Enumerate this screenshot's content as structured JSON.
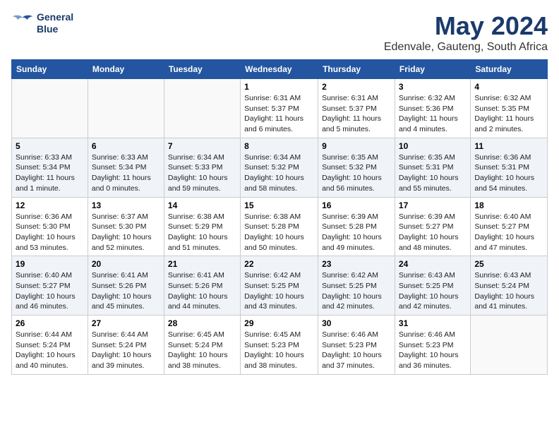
{
  "header": {
    "logo_line1": "General",
    "logo_line2": "Blue",
    "month": "May 2024",
    "location": "Edenvale, Gauteng, South Africa"
  },
  "days_of_week": [
    "Sunday",
    "Monday",
    "Tuesday",
    "Wednesday",
    "Thursday",
    "Friday",
    "Saturday"
  ],
  "weeks": [
    [
      {
        "day": "",
        "info": ""
      },
      {
        "day": "",
        "info": ""
      },
      {
        "day": "",
        "info": ""
      },
      {
        "day": "1",
        "info": "Sunrise: 6:31 AM\nSunset: 5:37 PM\nDaylight: 11 hours\nand 6 minutes."
      },
      {
        "day": "2",
        "info": "Sunrise: 6:31 AM\nSunset: 5:37 PM\nDaylight: 11 hours\nand 5 minutes."
      },
      {
        "day": "3",
        "info": "Sunrise: 6:32 AM\nSunset: 5:36 PM\nDaylight: 11 hours\nand 4 minutes."
      },
      {
        "day": "4",
        "info": "Sunrise: 6:32 AM\nSunset: 5:35 PM\nDaylight: 11 hours\nand 2 minutes."
      }
    ],
    [
      {
        "day": "5",
        "info": "Sunrise: 6:33 AM\nSunset: 5:34 PM\nDaylight: 11 hours\nand 1 minute."
      },
      {
        "day": "6",
        "info": "Sunrise: 6:33 AM\nSunset: 5:34 PM\nDaylight: 11 hours\nand 0 minutes."
      },
      {
        "day": "7",
        "info": "Sunrise: 6:34 AM\nSunset: 5:33 PM\nDaylight: 10 hours\nand 59 minutes."
      },
      {
        "day": "8",
        "info": "Sunrise: 6:34 AM\nSunset: 5:32 PM\nDaylight: 10 hours\nand 58 minutes."
      },
      {
        "day": "9",
        "info": "Sunrise: 6:35 AM\nSunset: 5:32 PM\nDaylight: 10 hours\nand 56 minutes."
      },
      {
        "day": "10",
        "info": "Sunrise: 6:35 AM\nSunset: 5:31 PM\nDaylight: 10 hours\nand 55 minutes."
      },
      {
        "day": "11",
        "info": "Sunrise: 6:36 AM\nSunset: 5:31 PM\nDaylight: 10 hours\nand 54 minutes."
      }
    ],
    [
      {
        "day": "12",
        "info": "Sunrise: 6:36 AM\nSunset: 5:30 PM\nDaylight: 10 hours\nand 53 minutes."
      },
      {
        "day": "13",
        "info": "Sunrise: 6:37 AM\nSunset: 5:30 PM\nDaylight: 10 hours\nand 52 minutes."
      },
      {
        "day": "14",
        "info": "Sunrise: 6:38 AM\nSunset: 5:29 PM\nDaylight: 10 hours\nand 51 minutes."
      },
      {
        "day": "15",
        "info": "Sunrise: 6:38 AM\nSunset: 5:28 PM\nDaylight: 10 hours\nand 50 minutes."
      },
      {
        "day": "16",
        "info": "Sunrise: 6:39 AM\nSunset: 5:28 PM\nDaylight: 10 hours\nand 49 minutes."
      },
      {
        "day": "17",
        "info": "Sunrise: 6:39 AM\nSunset: 5:27 PM\nDaylight: 10 hours\nand 48 minutes."
      },
      {
        "day": "18",
        "info": "Sunrise: 6:40 AM\nSunset: 5:27 PM\nDaylight: 10 hours\nand 47 minutes."
      }
    ],
    [
      {
        "day": "19",
        "info": "Sunrise: 6:40 AM\nSunset: 5:27 PM\nDaylight: 10 hours\nand 46 minutes."
      },
      {
        "day": "20",
        "info": "Sunrise: 6:41 AM\nSunset: 5:26 PM\nDaylight: 10 hours\nand 45 minutes."
      },
      {
        "day": "21",
        "info": "Sunrise: 6:41 AM\nSunset: 5:26 PM\nDaylight: 10 hours\nand 44 minutes."
      },
      {
        "day": "22",
        "info": "Sunrise: 6:42 AM\nSunset: 5:25 PM\nDaylight: 10 hours\nand 43 minutes."
      },
      {
        "day": "23",
        "info": "Sunrise: 6:42 AM\nSunset: 5:25 PM\nDaylight: 10 hours\nand 42 minutes."
      },
      {
        "day": "24",
        "info": "Sunrise: 6:43 AM\nSunset: 5:25 PM\nDaylight: 10 hours\nand 42 minutes."
      },
      {
        "day": "25",
        "info": "Sunrise: 6:43 AM\nSunset: 5:24 PM\nDaylight: 10 hours\nand 41 minutes."
      }
    ],
    [
      {
        "day": "26",
        "info": "Sunrise: 6:44 AM\nSunset: 5:24 PM\nDaylight: 10 hours\nand 40 minutes."
      },
      {
        "day": "27",
        "info": "Sunrise: 6:44 AM\nSunset: 5:24 PM\nDaylight: 10 hours\nand 39 minutes."
      },
      {
        "day": "28",
        "info": "Sunrise: 6:45 AM\nSunset: 5:24 PM\nDaylight: 10 hours\nand 38 minutes."
      },
      {
        "day": "29",
        "info": "Sunrise: 6:45 AM\nSunset: 5:23 PM\nDaylight: 10 hours\nand 38 minutes."
      },
      {
        "day": "30",
        "info": "Sunrise: 6:46 AM\nSunset: 5:23 PM\nDaylight: 10 hours\nand 37 minutes."
      },
      {
        "day": "31",
        "info": "Sunrise: 6:46 AM\nSunset: 5:23 PM\nDaylight: 10 hours\nand 36 minutes."
      },
      {
        "day": "",
        "info": ""
      }
    ]
  ]
}
